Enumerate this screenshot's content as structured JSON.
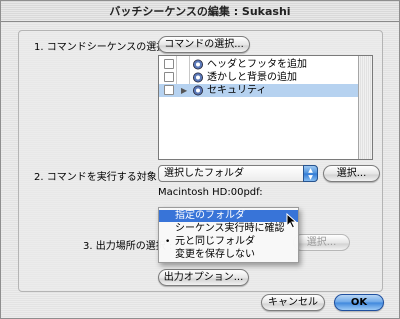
{
  "window": {
    "title": "バッチシーケンスの編集 : Sukashi"
  },
  "step1": {
    "label": "1. コマンドシーケンスの選択 :",
    "button": "コマンドの選択...",
    "items": [
      {
        "label": "ヘッダとフッタを追加",
        "checked": false,
        "selected": false,
        "expandable": false
      },
      {
        "label": "透かしと背景の追加",
        "checked": false,
        "selected": false,
        "expandable": false
      },
      {
        "label": "セキュリティ",
        "checked": false,
        "selected": true,
        "expandable": true
      }
    ]
  },
  "step2": {
    "label": "2. コマンドを実行する対象 :",
    "popup_value": "選択したフォルダ",
    "button": "選択...",
    "path": "Macintosh HD:00pdf:"
  },
  "step3": {
    "label": "3. 出力場所の選択 :",
    "button": "選択...",
    "options_button": "出力オプション...",
    "menu": {
      "highlighted": "指定のフォルダ",
      "items": [
        {
          "label": "指定のフォルダ",
          "marked": false
        },
        {
          "label": "シーケンス実行時に確認",
          "marked": false
        },
        {
          "label": "元と同じフォルダ",
          "marked": true
        },
        {
          "label": "変更を保存しない",
          "marked": false
        }
      ]
    }
  },
  "footer": {
    "cancel": "キャンセル",
    "ok": "OK"
  },
  "icons": {
    "menu_bullet": "•",
    "disclosure": "▶",
    "popup_arrows": "▲▼"
  },
  "colors": {
    "selection": "#b6d2f0",
    "menu_highlight": "#3874d8",
    "default_button": "#3d86dc"
  }
}
